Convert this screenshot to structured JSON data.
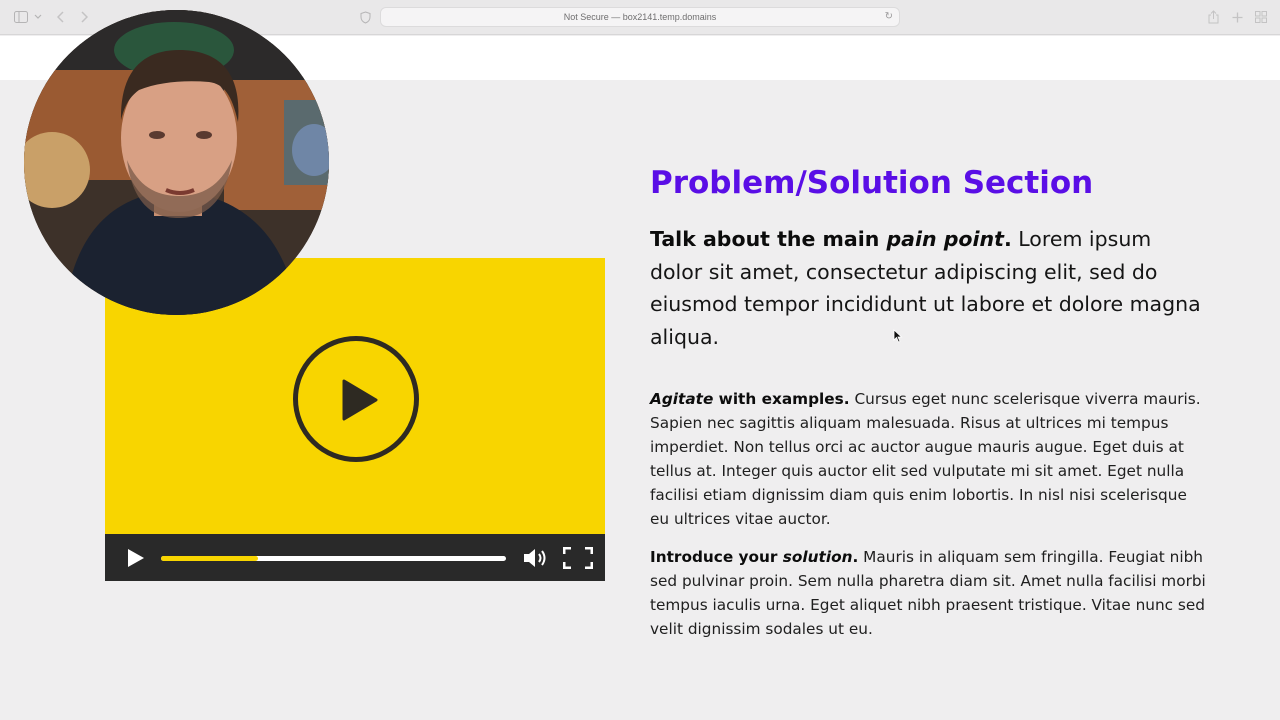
{
  "browser": {
    "address": "Not Secure — box2141.temp.domains"
  },
  "video": {
    "progress": 0.28,
    "colors": {
      "screen": "#f8d500",
      "controls": "#292929",
      "progress": "#f8d500"
    }
  },
  "section": {
    "heading": "Problem/Solution Section",
    "lead": {
      "bold_start": "Talk about the main ",
      "bold_italic": "pain point",
      "bold_end": ".",
      "text": " Lorem ipsum dolor sit amet, consectetur adipiscing elit, sed do eiusmod tempor incididunt ut labore et dolore magna aliqua."
    },
    "agitate": {
      "bold_italic": "Agitate",
      "bold": " with examples.",
      "text": " Cursus eget nunc scelerisque viverra mauris. Sapien nec sagittis aliquam malesuada. Risus at ultrices mi tempus imperdiet. Non tellus orci ac auctor augue mauris augue. Eget duis at tellus at. Integer quis auctor elit sed vulputate mi sit amet. Eget nulla facilisi etiam dignissim diam quis enim lobortis. In nisl nisi scelerisque eu ultrices vitae auctor."
    },
    "introduce": {
      "bold": "Introduce your ",
      "bold_italic": "solution",
      "bold_end": ".",
      "text": " Mauris in aliquam sem fringilla. Feugiat nibh sed pulvinar proin. Sem nulla pharetra diam sit. Amet nulla facilisi morbi tempus iaculis urna. Eget aliquet nibh praesent tristique. Vitae nunc sed velit dignissim sodales ut eu."
    }
  },
  "colors": {
    "heading": "#5a0ee6",
    "page_bg": "#efeeef"
  }
}
